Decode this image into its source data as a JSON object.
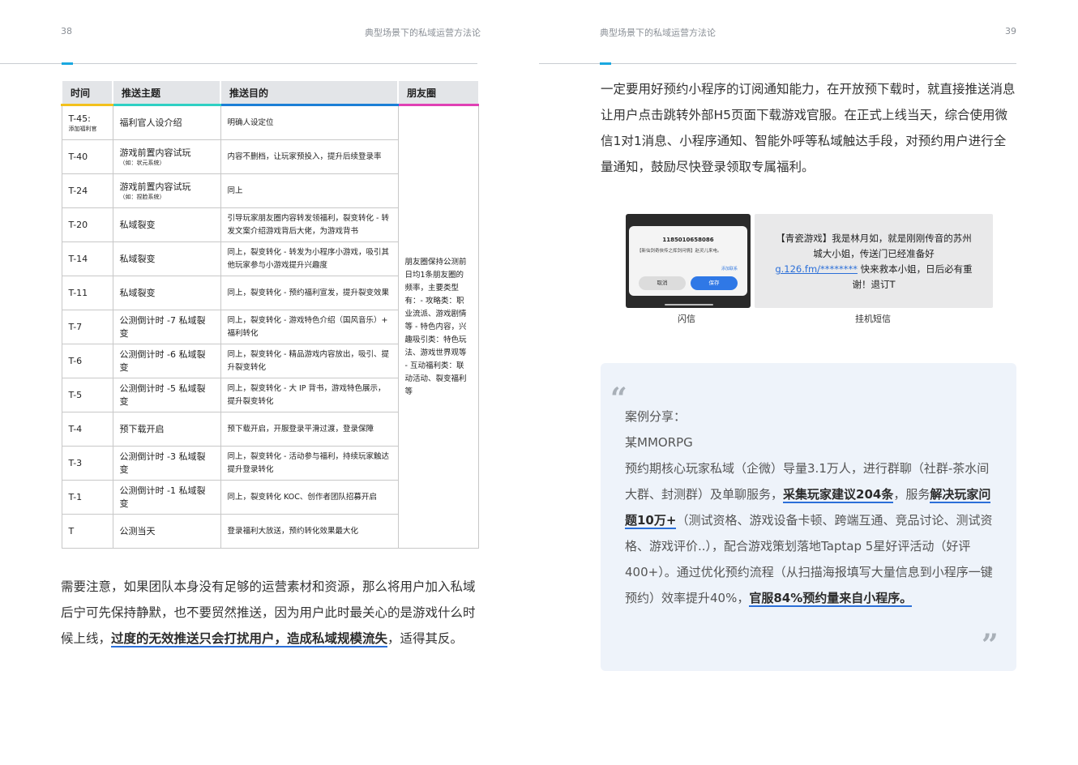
{
  "left_page": {
    "page_number": "38",
    "running_title": "典型场景下的私域运营方法论",
    "table": {
      "headers": [
        "时间",
        "推送主题",
        "推送目的",
        "朋友圈"
      ],
      "rows": [
        {
          "time": "T-45:",
          "time_note": "添加福利官",
          "topic": "福利官人设介绍",
          "topic_note": "",
          "purpose": "明确人设定位"
        },
        {
          "time": "T-40",
          "time_note": "",
          "topic": "游戏前置内容试玩",
          "topic_note": "（如：状元系统）",
          "purpose": "内容不删档，让玩家预投入，提升后续登录率"
        },
        {
          "time": "T-24",
          "time_note": "",
          "topic": "游戏前置内容试玩",
          "topic_note": "（如：捏脸系统）",
          "purpose": "同上"
        },
        {
          "time": "T-20",
          "time_note": "",
          "topic": "私域裂变",
          "topic_note": "",
          "purpose": "引导玩家朋友圈内容转发领福利，裂变转化 - 转发文案介绍游戏背后大佬，为游戏背书"
        },
        {
          "time": "T-14",
          "time_note": "",
          "topic": "私域裂变",
          "topic_note": "",
          "purpose": "同上，裂变转化 - 转发为小程序小游戏，吸引其他玩家参与小游戏提升兴趣度"
        },
        {
          "time": "T-11",
          "time_note": "",
          "topic": "私域裂变",
          "topic_note": "",
          "purpose": "同上，裂变转化 - 预约福利宣发，提升裂变效果"
        },
        {
          "time": "T-7",
          "time_note": "",
          "topic": "公测倒计时 -7 私域裂变",
          "topic_note": "",
          "purpose": "同上，裂变转化 - 游戏特色介绍（国风音乐）+ 福利转化"
        },
        {
          "time": "T-6",
          "time_note": "",
          "topic": "公测倒计时 -6 私域裂变",
          "topic_note": "",
          "purpose": "同上，裂变转化 - 精品游戏内容放出，吸引、提升裂变转化"
        },
        {
          "time": "T-5",
          "time_note": "",
          "topic": "公测倒计时 -5 私域裂变",
          "topic_note": "",
          "purpose": "同上，裂变转化 - 大 IP 背书，游戏特色展示，提升裂变转化"
        },
        {
          "time": "T-4",
          "time_note": "",
          "topic": "预下载开启",
          "topic_note": "",
          "purpose": "预下载开启，开服登录平滑过渡，登录保障"
        },
        {
          "time": "T-3",
          "time_note": "",
          "topic": "公测倒计时 -3 私域裂变",
          "topic_note": "",
          "purpose": "同上，裂变转化 - 活动参与福利，持续玩家触达提升登录转化"
        },
        {
          "time": "T-1",
          "time_note": "",
          "topic": "公测倒计时 -1 私域裂变",
          "topic_note": "",
          "purpose": "同上，裂变转化 KOC、创作者团队招募开启"
        },
        {
          "time": "T",
          "time_note": "",
          "topic": "公测当天",
          "topic_note": "",
          "purpose": "登录福利大放送，预约转化效果最大化"
        }
      ],
      "moments": "朋友圈保持公测前日均1条朋友圈的频率，主要类型有：- 攻略类：职业流派、游戏剧情等 - 特色内容，兴趣吸引类：特色玩法、游戏世界观等 - 互动福利类：联动活动、裂变福利等"
    },
    "note_para_1": "需要注意，如果团队本身没有足够的运营素材和资源，那么将用户加入私域后宁可先保持静默，也不要贸然推送，因为用户此时最关心的是游戏什么时候上线，",
    "note_highlight": "过度的无效推送只会打扰用户，造成私域规模流失",
    "note_para_2": "，适得其反。"
  },
  "right_page": {
    "page_number": "39",
    "running_title": "典型场景下的私域运营方法论",
    "intro": "一定要用好预约小程序的订阅通知能力，在开放预下载时，就直接推送消息让用户点击跳转外部H5页面下载游戏官服。在正式上线当天，综合使用微信1对1消息、小程序通知、智能外呼等私域触达手段，对预约用户进行全量通知，鼓励尽快登录领取专属福利。",
    "flash": {
      "number": "1185010658086",
      "message": "【新仙剑奇侠传之挥剑问情】赵灵儿来电。",
      "report": "添加联系",
      "cancel": "取消",
      "save": "保存",
      "caption": "闪信"
    },
    "sms": {
      "text_1": "【青瓷游戏】我是林月如，就是刚刚传音的苏州城大小姐，传送门已经准备好",
      "link": "g.126.fm/********",
      "text_2": " 快来救本小姐，日后必有重谢！退订T",
      "caption": "挂机短信"
    },
    "quote": {
      "open_mark": "“",
      "close_mark": "”",
      "title": "案例分享：",
      "subtitle": "某MMORPG",
      "body_1": "预约期核心玩家私域（企微）导量3.1万人，进行群聊（社群-茶水间大群、封测群）及单聊服务，",
      "hl_1": "采集玩家建议204条",
      "body_2": "，服务",
      "hl_2": "解决玩家问题10万+",
      "body_3": "（测试资格、游戏设备卡顿、跨端互通、竞品讨论、测试资格、游戏评价..），配合游戏策划落地Taptap 5星好评活动（好评400+）。通过优化预约流程（从扫描海报填写大量信息到小程序一键预约）效率提升40%，",
      "hl_3": "官服84%预约量来自小程序。"
    }
  }
}
